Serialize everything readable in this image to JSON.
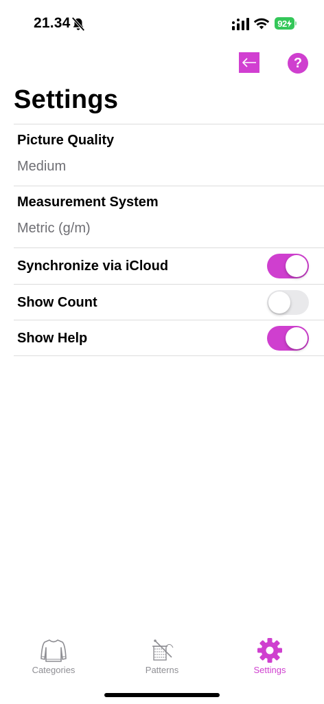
{
  "status_bar": {
    "time": "21.34",
    "battery": "92",
    "icons": [
      "bell-slash-icon",
      "cellular-signal-icon",
      "wifi-icon",
      "battery-charging-icon"
    ]
  },
  "toolbar": {
    "back_icon": "arrow-left-icon",
    "help_label": "?"
  },
  "page": {
    "title": "Settings"
  },
  "settings": {
    "picture_quality": {
      "label": "Picture Quality",
      "value": "Medium"
    },
    "measurement_system": {
      "label": "Measurement System",
      "value": "Metric (g/m)"
    },
    "sync_icloud": {
      "label": "Synchronize via iCloud",
      "on": true
    },
    "show_count": {
      "label": "Show Count",
      "on": false
    },
    "show_help": {
      "label": "Show Help",
      "on": true
    }
  },
  "tabs": [
    {
      "label": "Categories",
      "icon": "sweater-icon",
      "active": false
    },
    {
      "label": "Patterns",
      "icon": "knitting-icon",
      "active": false
    },
    {
      "label": "Settings",
      "icon": "gear-icon",
      "active": true
    }
  ],
  "colors": {
    "accent": "#cf3fcf",
    "toggle_off": "#e9e9eb",
    "battery": "#34c759",
    "secondary_text": "#6e6e73",
    "tab_inactive": "#8e8e93"
  }
}
